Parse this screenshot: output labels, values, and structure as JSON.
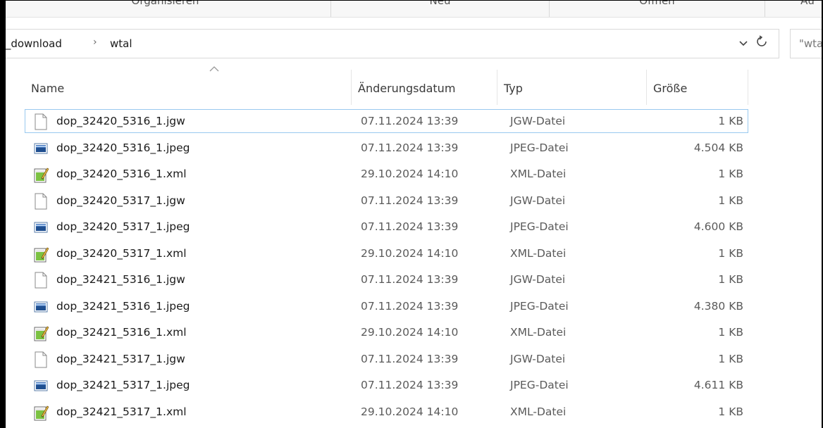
{
  "ribbon": {
    "groups": [
      "Organisieren",
      "Neu",
      "Öffnen",
      "Au"
    ]
  },
  "address": {
    "crumbs": [
      "s_download",
      "wtal"
    ],
    "separator_icon": "chevron-right-icon",
    "dropdown_icon": "chevron-down-icon",
    "refresh_icon": "refresh-icon"
  },
  "search": {
    "text": "\"wtal\""
  },
  "columns": {
    "name": "Name",
    "date": "Änderungsdatum",
    "type": "Typ",
    "size": "Größe",
    "sort_icon": "sort-ascending-icon"
  },
  "files": [
    {
      "name": "dop_32420_5316_1.jgw",
      "date": "07.11.2024 13:39",
      "type": "JGW-Datei",
      "size": "1 KB",
      "icon": "blank-file-icon"
    },
    {
      "name": "dop_32420_5316_1.jpeg",
      "date": "07.11.2024 13:39",
      "type": "JPEG-Datei",
      "size": "4.504 KB",
      "icon": "image-file-icon"
    },
    {
      "name": "dop_32420_5316_1.xml",
      "date": "29.10.2024 14:10",
      "type": "XML-Datei",
      "size": "1 KB",
      "icon": "xml-file-icon"
    },
    {
      "name": "dop_32420_5317_1.jgw",
      "date": "07.11.2024 13:39",
      "type": "JGW-Datei",
      "size": "1 KB",
      "icon": "blank-file-icon"
    },
    {
      "name": "dop_32420_5317_1.jpeg",
      "date": "07.11.2024 13:39",
      "type": "JPEG-Datei",
      "size": "4.600 KB",
      "icon": "image-file-icon"
    },
    {
      "name": "dop_32420_5317_1.xml",
      "date": "29.10.2024 14:10",
      "type": "XML-Datei",
      "size": "1 KB",
      "icon": "xml-file-icon"
    },
    {
      "name": "dop_32421_5316_1.jgw",
      "date": "07.11.2024 13:39",
      "type": "JGW-Datei",
      "size": "1 KB",
      "icon": "blank-file-icon"
    },
    {
      "name": "dop_32421_5316_1.jpeg",
      "date": "07.11.2024 13:39",
      "type": "JPEG-Datei",
      "size": "4.380 KB",
      "icon": "image-file-icon"
    },
    {
      "name": "dop_32421_5316_1.xml",
      "date": "29.10.2024 14:10",
      "type": "XML-Datei",
      "size": "1 KB",
      "icon": "xml-file-icon"
    },
    {
      "name": "dop_32421_5317_1.jgw",
      "date": "07.11.2024 13:39",
      "type": "JGW-Datei",
      "size": "1 KB",
      "icon": "blank-file-icon"
    },
    {
      "name": "dop_32421_5317_1.jpeg",
      "date": "07.11.2024 13:39",
      "type": "JPEG-Datei",
      "size": "4.611 KB",
      "icon": "image-file-icon"
    },
    {
      "name": "dop_32421_5317_1.xml",
      "date": "29.10.2024 14:10",
      "type": "XML-Datei",
      "size": "1 KB",
      "icon": "xml-file-icon"
    }
  ],
  "colors": {
    "focus_border": "#99c9ef",
    "xml_icon_green": "#7cc242",
    "image_icon_blue": "#3d6fb6"
  }
}
